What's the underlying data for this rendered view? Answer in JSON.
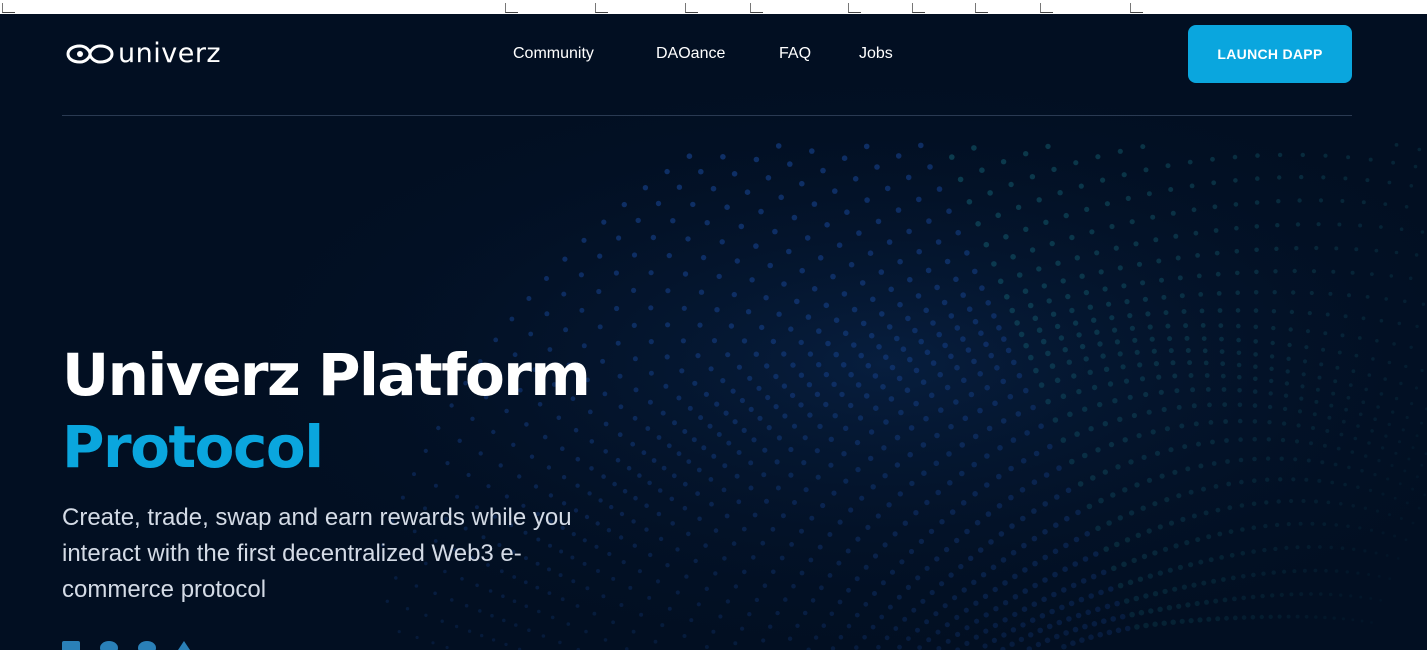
{
  "brand": {
    "name": "univerz"
  },
  "nav": {
    "items": [
      {
        "label": "Community"
      },
      {
        "label": "DAOance"
      },
      {
        "label": "FAQ"
      },
      {
        "label": "Jobs"
      }
    ]
  },
  "cta": {
    "label": "LAUNCH DAPP"
  },
  "hero": {
    "title_line1": "Univerz Platform",
    "title_line2": "Protocol",
    "subtitle": "Create, trade, swap and earn rewards while you interact with the first decentralized Web3 e-commerce protocol"
  },
  "colors": {
    "background": "#020f22",
    "accent": "#0aa6de",
    "text": "#ffffff",
    "subtext": "#d4dbe6",
    "divider": "#2a3a52"
  },
  "icons": {
    "logo": "infinity-link-icon",
    "background": "dotted-wave-graphic"
  }
}
